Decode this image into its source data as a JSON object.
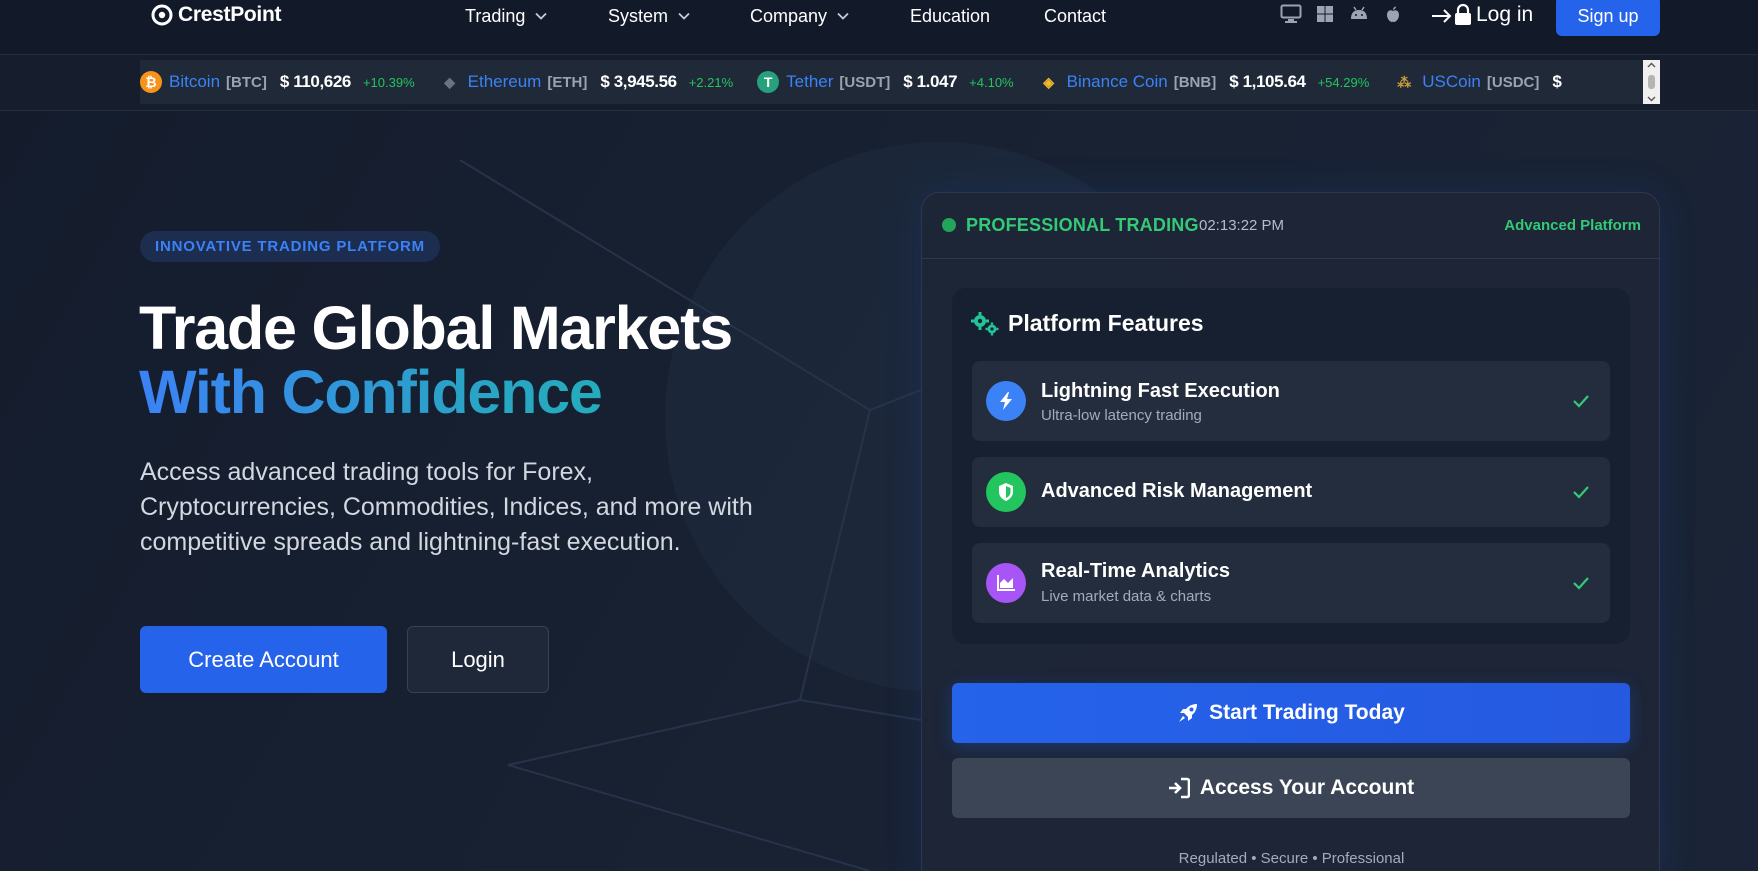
{
  "navbar": {
    "brand": "CrestPoint",
    "items": [
      {
        "label": "Trading",
        "has_dropdown": true
      },
      {
        "label": "System",
        "has_dropdown": true
      },
      {
        "label": "Company",
        "has_dropdown": true
      },
      {
        "label": "Education",
        "has_dropdown": false
      },
      {
        "label": "Contact",
        "has_dropdown": false
      }
    ],
    "platform_icons": [
      "desktop-icon",
      "windows-icon",
      "android-icon",
      "apple-icon"
    ],
    "login_label": "Log in",
    "signup_label": "Sign up"
  },
  "ticker": {
    "items": [
      {
        "name": "Bitcoin",
        "symbol": "[BTC]",
        "price": "$ 110,626",
        "change": "+10.39%",
        "icon": "bitcoin-icon",
        "color": "#f7931a"
      },
      {
        "name": "Ethereum",
        "symbol": "[ETH]",
        "price": "$ 3,945.56",
        "change": "+2.21%",
        "icon": "ethereum-icon",
        "color": "#6b7280"
      },
      {
        "name": "Tether",
        "symbol": "[USDT]",
        "price": "$ 1.047",
        "change": "+4.10%",
        "icon": "tether-icon",
        "color": "#26a17b"
      },
      {
        "name": "Binance Coin",
        "symbol": "[BNB]",
        "price": "$ 1,105.64",
        "change": "+54.29%",
        "icon": "binance-icon",
        "color": "#f3ba2f"
      },
      {
        "name": "USCoin",
        "symbol": "[USDC]",
        "price": "$",
        "change": "",
        "icon": "uscoin-icon",
        "color": "#c69a3a"
      }
    ]
  },
  "hero": {
    "badge": "INNOVATIVE TRADING PLATFORM",
    "title_line1": "Trade Global Markets",
    "title_line2": "With Confidence",
    "description": "Access advanced trading tools for Forex, Cryptocurrencies, Commodities, Indices, and more with competitive spreads and lightning-fast execution.",
    "create_account_label": "Create Account",
    "login_label": "Login"
  },
  "card": {
    "status": "PROFESSIONAL TRADING",
    "time": "02:13:22 PM",
    "tag": "Advanced Platform",
    "features_title": "Platform Features",
    "features": [
      {
        "title": "Lightning Fast Execution",
        "subtitle": "Ultra-low latency trading",
        "icon": "lightning-icon",
        "color": "#3b82f6"
      },
      {
        "title": "Advanced Risk Management",
        "subtitle": "",
        "icon": "shield-icon",
        "color": "#22c55e"
      },
      {
        "title": "Real-Time Analytics",
        "subtitle": "Live market data & charts",
        "icon": "analytics-chart-icon",
        "color": "#a855f7"
      }
    ],
    "start_label": "Start Trading Today",
    "access_label": "Access Your Account",
    "footer": "Regulated • Secure • Professional"
  },
  "colors": {
    "accent": "#2563eb",
    "success": "#34c976",
    "background": "#131b2b"
  }
}
